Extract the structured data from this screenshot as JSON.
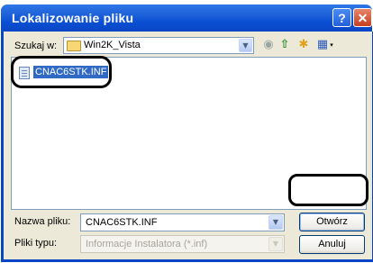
{
  "window": {
    "title": "Lokalizowanie pliku",
    "help_button": "?",
    "close_button": "✕"
  },
  "toolbar": {
    "look_in_label": "Szukaj w:",
    "look_in_value": "Win2K_Vista",
    "look_in_arrow": "▼",
    "back_icon": "◉",
    "up_icon": "⇧",
    "new_folder_icon": "✱",
    "views_icon": "▦",
    "views_arrow": "▾"
  },
  "filelist": {
    "items": [
      {
        "name": "CNAC6STK.INF",
        "selected": true
      }
    ]
  },
  "form": {
    "file_name_label": "Nazwa pliku:",
    "file_name_value": "CNAC6STK.INF",
    "file_type_label": "Pliki typu:",
    "file_type_value": "Informacje Instalatora (*.inf)",
    "dropdown_arrow": "▼"
  },
  "buttons": {
    "open_label": "Otwórz",
    "cancel_label": "Anuluj"
  },
  "colors": {
    "titlebar": "#0a4fd3",
    "dialog_bg": "#ece9d8",
    "selection": "#316ac5"
  }
}
